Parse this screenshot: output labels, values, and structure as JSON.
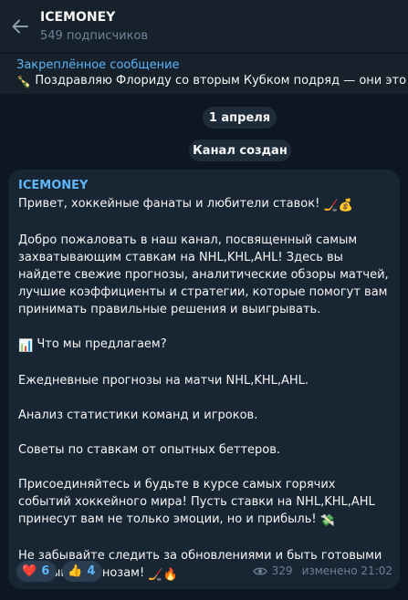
{
  "header": {
    "title": "ICEMONEY",
    "subtitle": "549 подписчиков",
    "back_icon": "arrow-left-icon"
  },
  "pinned": {
    "label": "Закреплённое сообщение",
    "text": "Поздравляю Флориду со вторым Кубком подряд — они это з",
    "emoji": "🍾"
  },
  "service": {
    "date": "1 апреля",
    "created": "Канал создан"
  },
  "message": {
    "author": "ICEMONEY",
    "greeting": "Привет, хоккейные фанаты и любители ставок!",
    "greeting_emoji": "🏒💰",
    "paragraph1": "Добро пожаловать в наш канал, посвященный самым захватывающим ставкам на NHL,KHL,AHL! Здесь вы найдете свежие прогнозы, аналитические обзоры матчей, лучшие коэффициенты и стратегии, которые помогут вам принимать правильные решения и выигрывать.",
    "offer_emoji": "📊",
    "offer_title": "Что мы предлагаем?",
    "item1": "Ежедневные прогнозы на матчи NHL,KHL,AHL.",
    "item2": "Анализ статистики команд и игроков.",
    "item3": "Советы по ставкам от опытных беттеров.",
    "join_text": "Присоединяйтесь и будьте в курсе самых горячих событий хоккейного мира! Пусть ставки на NHL,KHL,AHL принесут вам не только эмоции, но и прибыль!",
    "join_emoji": "💸",
    "closing": "Не забывайте следить за обновлениями и быть готовыми к новым прогнозам!",
    "closing_emoji": "🏒🔥",
    "reactions": [
      {
        "emoji": "❤️",
        "count": "6"
      },
      {
        "emoji": "👍",
        "count": "4"
      }
    ],
    "views": "329",
    "edited": "изменено 21:02"
  },
  "colors": {
    "background": "#0e1621",
    "header": "#17212b",
    "bubble": "#182533",
    "accent": "#5eb5f7",
    "muted": "#708499"
  }
}
